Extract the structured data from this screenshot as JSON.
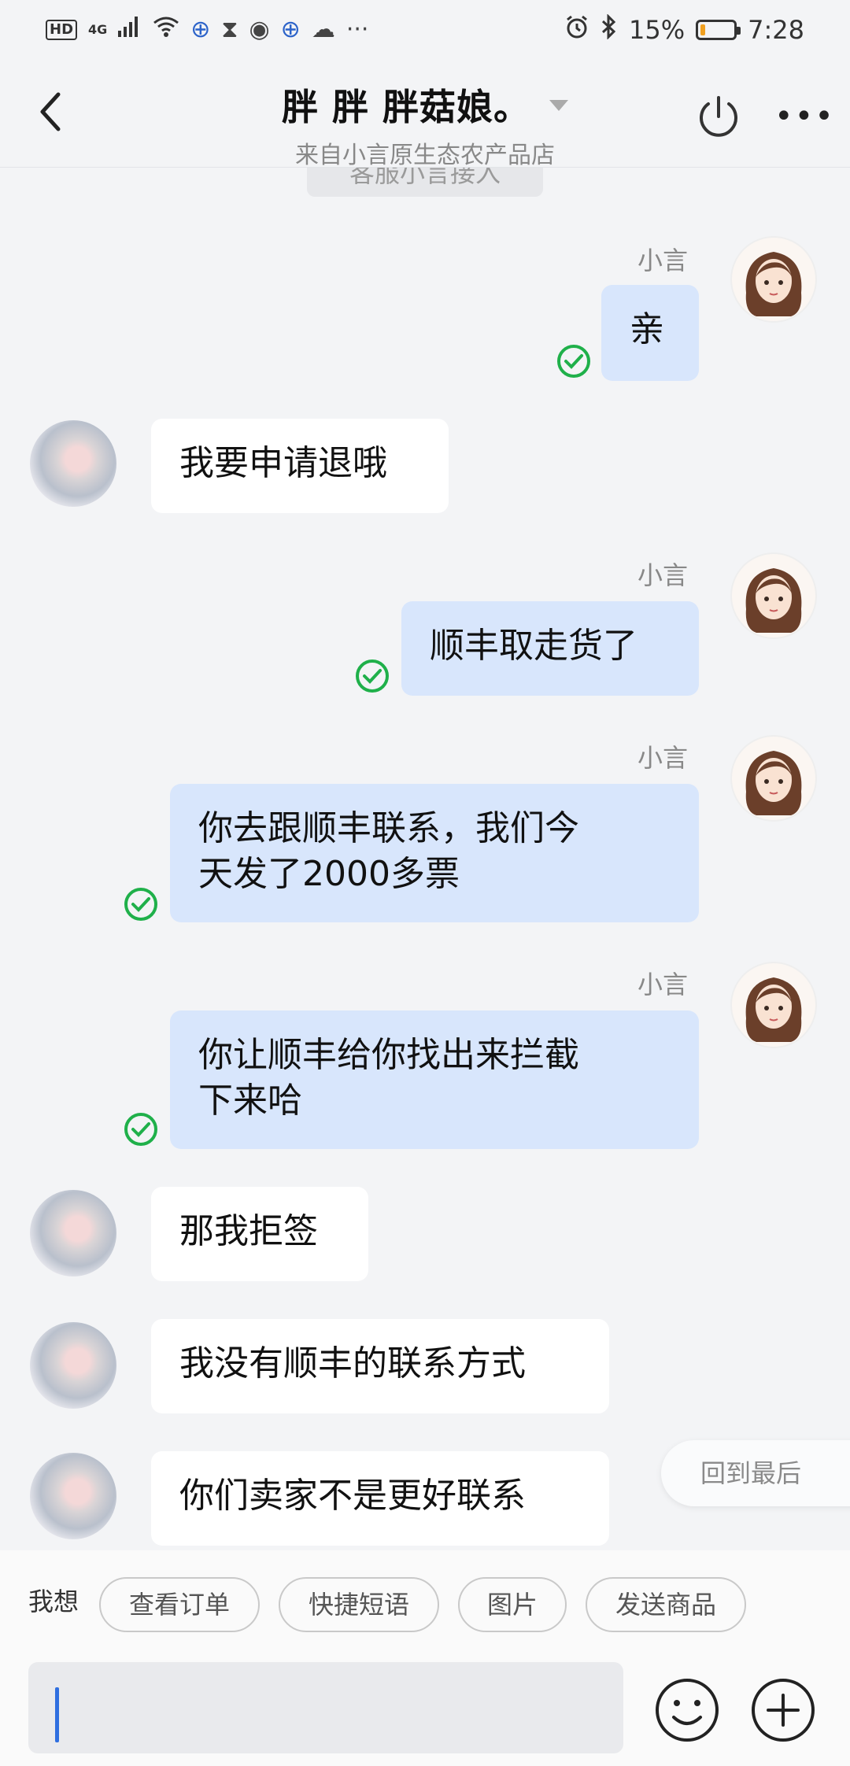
{
  "status_bar": {
    "left_icons": [
      "HD",
      "4G",
      "signal-icon",
      "wifi-icon",
      "app-icon",
      "hourglass-icon",
      "music-icon",
      "app-icon",
      "wechat-icon",
      "more-dots"
    ],
    "network": "4G",
    "hd": "HD",
    "battery_percent_text": "15%",
    "battery_level": 0.15,
    "time": "7:28",
    "icons_right": [
      "alarm-icon",
      "bluetooth-icon",
      "battery-icon"
    ]
  },
  "header": {
    "title": "胖 胖 胖菇娘。",
    "subtitle": "来自小言原生态农产品店",
    "icons": [
      "back-icon",
      "dropdown-caret-icon",
      "power-icon",
      "more-icon"
    ]
  },
  "system_notice": "客服小言接入",
  "messages": [
    {
      "side": "out",
      "sender": "小言",
      "text": "亲",
      "status": "read-check-icon"
    },
    {
      "side": "in",
      "text": "我要申请退哦"
    },
    {
      "side": "out",
      "sender": "小言",
      "text": "顺丰取走货了",
      "status": "read-check-icon"
    },
    {
      "side": "out",
      "sender": "小言",
      "text_lines": [
        "你去跟顺丰联系，我们今",
        "天发了2000多票"
      ],
      "status": "read-check-icon"
    },
    {
      "side": "out",
      "sender": "小言",
      "text_lines": [
        "你让顺丰给你找出来拦截",
        "下来哈"
      ],
      "status": "read-check-icon"
    },
    {
      "side": "in",
      "text": "那我拒签"
    },
    {
      "side": "in",
      "text": "我没有顺丰的联系方式"
    },
    {
      "side": "in",
      "text": "你们卖家不是更好联系"
    }
  ],
  "back_to_latest": "回到最后",
  "quick_actions": {
    "label": "我想",
    "chips": [
      "查看订单",
      "快捷短语",
      "图片",
      "发送商品"
    ]
  },
  "input": {
    "value": "",
    "icons": [
      "emoji-icon",
      "plus-icon"
    ]
  },
  "colors": {
    "background": "#f3f4f6",
    "outgoing_bubble": "#d8e6fc",
    "incoming_bubble": "#ffffff",
    "check_green": "#1fb04a",
    "cursor_blue": "#2f6fe0",
    "battery_orange": "#f0a020"
  }
}
